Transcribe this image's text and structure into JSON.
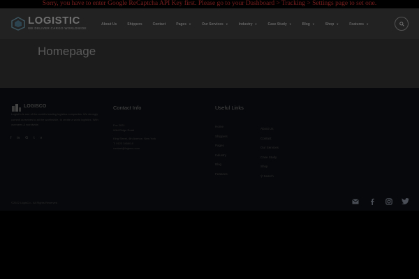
{
  "notice": {
    "text": "Sorry, you have to enter Google ReCaptcha API Key first. Please go to your Dashboard > Tracking > Settings page to set one."
  },
  "header": {
    "logo_text": "LOGISTIC",
    "logo_tagline": "WE DELIVER CARGO WORLDWIDE",
    "nav": [
      {
        "label": "About Us",
        "has_menu": false
      },
      {
        "label": "Shippers",
        "has_menu": false
      },
      {
        "label": "Contact",
        "has_menu": false
      },
      {
        "label": "Pages",
        "has_menu": true
      },
      {
        "label": "Our Services",
        "has_menu": true
      },
      {
        "label": "Industry",
        "has_menu": true
      },
      {
        "label": "Case Study",
        "has_menu": true
      },
      {
        "label": "Blog",
        "has_menu": true
      },
      {
        "label": "Shop",
        "has_menu": true
      },
      {
        "label": "Features",
        "has_menu": true
      }
    ],
    "search_icon": "search-icon"
  },
  "page": {
    "title": "Homepage"
  },
  "footer": {
    "logo_text": "LOGISCO",
    "about": "LogisCo is one of the world's leading logistics companies. We strongly commit ourselves to all the worthwhile, to create a world logistics. With oversees & worldwide.",
    "social_icons": [
      "facebook-icon",
      "linkedin-icon",
      "google-plus-icon",
      "twitter-icon",
      "vimeo-icon"
    ],
    "contact": {
      "title": "Contact Info",
      "lines_a": [
        "Fox 2021",
        "Wild Ridge Road"
      ],
      "lines_b": [
        "King Street, 4th Avenue, New York",
        "T: 0123 34560 8",
        "contact@logisco.com"
      ]
    },
    "useful_links": {
      "title": "Useful Links",
      "col1": [
        "Home",
        "Shippers",
        "Pages",
        "Industry",
        "Blog",
        "Features"
      ],
      "col2": [
        "About Us",
        "Contact",
        "Our Services",
        "Case Study",
        "Shop",
        "Search"
      ]
    },
    "copyright": "©2022 LogisCo - All Rights Reserved",
    "bottom_icons": [
      "mail-icon",
      "facebook-icon",
      "instagram-icon",
      "twitter-icon"
    ]
  },
  "colors": {
    "overlay": "#000000",
    "header": "#222222",
    "title_bar": "#1c1c1c",
    "footer": "#07080b",
    "notice": "#7a1e1e"
  }
}
